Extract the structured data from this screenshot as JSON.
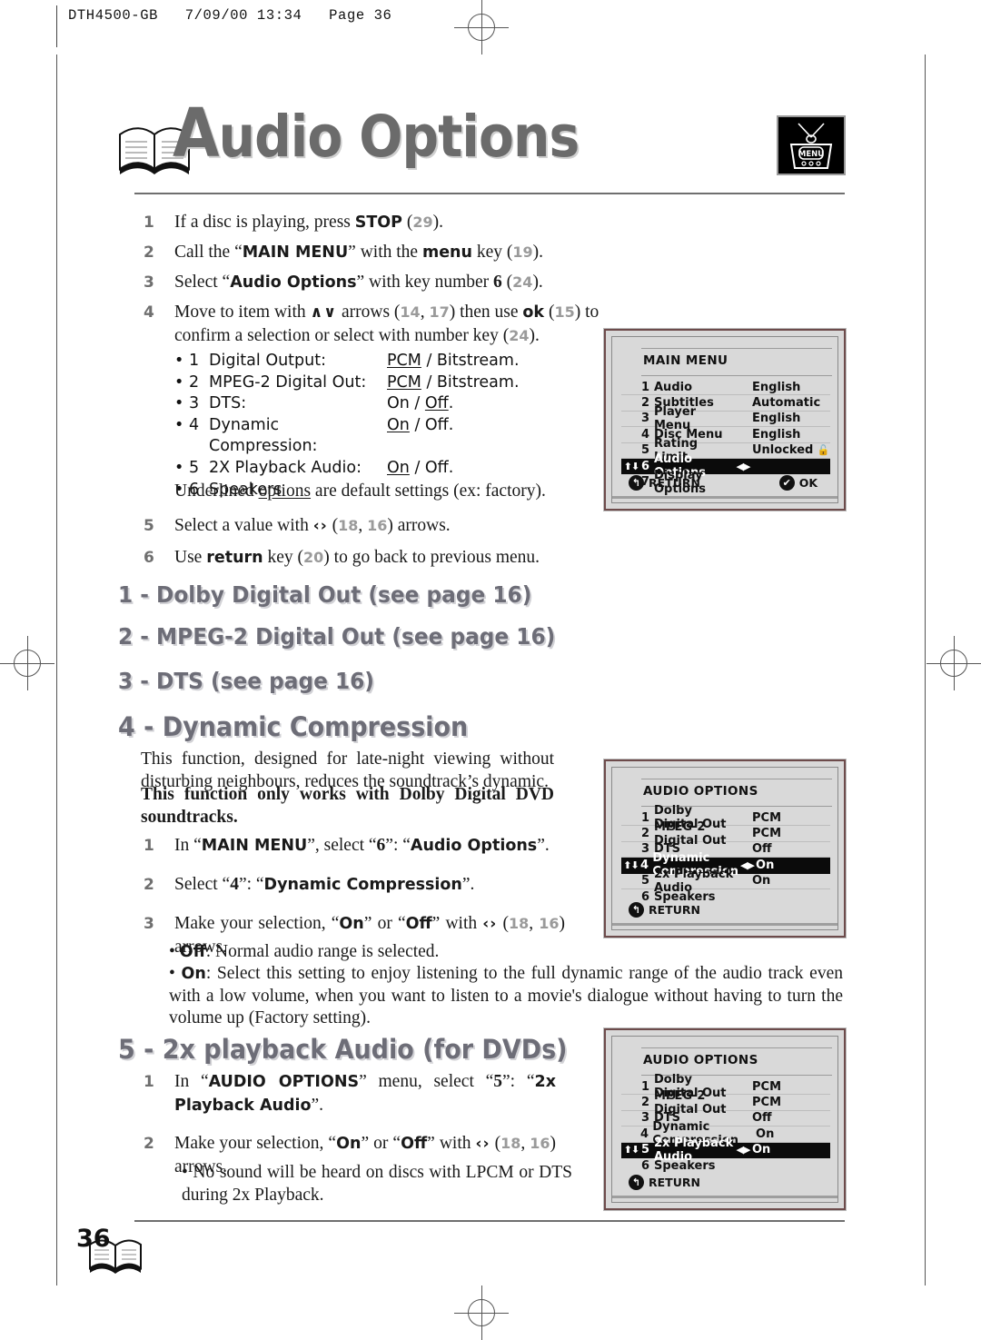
{
  "header": {
    "running_head": "DTH4500-GB   7/09/00 13:34   Page 36"
  },
  "title": {
    "text_cap": "A",
    "text_rest": "udio Options",
    "menu_icon_label": "MENU"
  },
  "intro_steps": [
    {
      "n": "1",
      "html": "If a disc is playing, press <b class=\"sans\">STOP</b> (<span class=\"ref\">29</span>)."
    },
    {
      "n": "2",
      "html": "Call the “<b class=\"sans\">MAIN MENU</b>” with the <b class=\"sans\">menu</b> key (<span class=\"ref\">19</span>)."
    },
    {
      "n": "3",
      "html": "Select “<b class=\"sans\">Audio Options</b>” with key number <b class=\"serif\">6</b> (<span class=\"ref\">24</span>)."
    },
    {
      "n": "4",
      "html": "Move to item with <span class=\"arrglyph\">∧∨</span> arrows (<span class=\"ref\">14</span>, <span class=\"ref\">17</span>) then use <b class=\"sans\">ok</b> (<span class=\"ref\">15</span>) to confirm a selection or select with number key (<span class=\"ref\">24</span>)."
    }
  ],
  "option_list": [
    {
      "index": "1",
      "label": "Digital Output:",
      "value_html": "<u>PCM</u> / Bitstream."
    },
    {
      "index": "2",
      "label": "MPEG-2 Digital Out:",
      "value_html": "<u>PCM</u> / Bitstream."
    },
    {
      "index": "3",
      "label": "DTS:",
      "value_html": "On / <u>Off</u>."
    },
    {
      "index": "4",
      "label": "Dynamic Compression:",
      "value_html": "<u>On</u> / Off."
    },
    {
      "index": "5",
      "label": "2X Playback Audio:",
      "value_html": "<u>On</u> / Off."
    },
    {
      "index": "6",
      "label": "Speakers",
      "value_html": ""
    }
  ],
  "underline_note_html": "Underlined <u>options</u> are default settings (ex: factory).",
  "intro_steps_2": [
    {
      "n": "5",
      "html": "Select a value with <span class=\"arrglyph\">‹›</span> (<span class=\"ref\">18</span>, <span class=\"ref\">16</span>) arrows."
    },
    {
      "n": "6",
      "html": "Use <b class=\"sans\">return</b> key (<span class=\"ref\">20</span>) to go back to previous menu."
    }
  ],
  "headings": {
    "h1": "1 - Dolby Digital Out (see page 16)",
    "h2": "2 - MPEG-2 Digital Out (see page 16)",
    "h3": "3 - DTS (see page 16)",
    "h4": "4 - Dynamic Compression",
    "h5": "5 - 2x playback Audio (for DVDs)"
  },
  "dynamic_compression": {
    "para_normal": "This function, designed for late-night viewing without disturbing neighbours, reduces the soundtrack’s dynamic.",
    "para_bold": "This function only works with Dolby Digital DVD soundtracks.",
    "steps": [
      {
        "n": "1",
        "html": "In “<b class=\"sans\">MAIN MENU</b>”, select “<b class=\"serif\">6</b>”: “<b class=\"sans\">Audio Options</b>”."
      },
      {
        "n": "2",
        "html": "Select “<b class=\"serif\">4</b>”: “<b class=\"sans\">Dynamic Compression</b>”."
      },
      {
        "n": "3",
        "html": "Make your selection, “<b class=\"sans\">On</b>” or “<b class=\"sans\">Off</b>” with <span class=\"arrglyph\">‹›</span> (<span class=\"ref\">18</span>, <span class=\"ref\">16</span>) arrows."
      }
    ],
    "bullet_off": "<b class=\"sans\">Off</b>: Normal audio range is selected.",
    "bullet_on": "<b class=\"sans\">On</b>: Select this setting to enjoy listening to the full  dynamic range of the audio track even with a low volume, when you want to listen to a movie's dialogue without having to turn the volume up (Factory setting)."
  },
  "playback_audio": {
    "steps": [
      {
        "n": "1",
        "html": "In “<b class=\"sans\">AUDIO OPTIONS</b>” menu, select “<b class=\"serif\">5</b>”: “<b class=\"sans\">2x Playback Audio</b>”."
      },
      {
        "n": "2",
        "html": "Make your selection, “<b class=\"sans\">On</b>” or “<b class=\"sans\">Off</b>” with <span class=\"arrglyph\">‹›</span> (<span class=\"ref\">18</span>, <span class=\"ref\">16</span>) arrows."
      }
    ],
    "bullet": "No sound will be heard on discs with LPCM or DTS during 2x Playback."
  },
  "screens": [
    {
      "title": "MAIN MENU",
      "rows": [
        {
          "n": "1",
          "label": "Audio",
          "value": "English",
          "highlight": false,
          "lock": false
        },
        {
          "n": "2",
          "label": "Subtitles",
          "value": "Automatic",
          "highlight": false,
          "lock": false
        },
        {
          "n": "3",
          "label": "Player Menu",
          "value": "English",
          "highlight": false,
          "lock": false
        },
        {
          "n": "4",
          "label": "Disc Menu",
          "value": "English",
          "highlight": false,
          "lock": false
        },
        {
          "n": "5",
          "label": "Rating Limit",
          "value": "Unlocked",
          "highlight": false,
          "lock": true
        },
        {
          "n": "6",
          "label": "Audio Options",
          "value": "",
          "highlight": true,
          "lock": false
        },
        {
          "n": "7",
          "label": "Display Options",
          "value": "",
          "highlight": false,
          "lock": false
        }
      ],
      "footer_left": "RETURN",
      "footer_right": "OK"
    },
    {
      "title": "AUDIO OPTIONS",
      "rows": [
        {
          "n": "1",
          "label": "Dolby Digital Out",
          "value": "PCM",
          "highlight": false,
          "lock": false
        },
        {
          "n": "2",
          "label": "MPEG-2 Digital Out",
          "value": "PCM",
          "highlight": false,
          "lock": false
        },
        {
          "n": "3",
          "label": "DTS",
          "value": "Off",
          "highlight": false,
          "lock": false
        },
        {
          "n": "4",
          "label": "Dynamic Compression",
          "value": "On",
          "highlight": true,
          "lock": false
        },
        {
          "n": "5",
          "label": "2x Playback Audio",
          "value": "On",
          "highlight": false,
          "lock": false
        },
        {
          "n": "6",
          "label": "Speakers",
          "value": "",
          "highlight": false,
          "lock": false
        }
      ],
      "footer_left": "RETURN",
      "footer_right": ""
    },
    {
      "title": "AUDIO OPTIONS",
      "rows": [
        {
          "n": "1",
          "label": "Dolby Digital Out",
          "value": "PCM",
          "highlight": false,
          "lock": false
        },
        {
          "n": "2",
          "label": "MPEG-2 Digital Out",
          "value": "PCM",
          "highlight": false,
          "lock": false
        },
        {
          "n": "3",
          "label": "DTS",
          "value": "Off",
          "highlight": false,
          "lock": false
        },
        {
          "n": "4",
          "label": "Dynamic Compression",
          "value": "On",
          "highlight": false,
          "lock": false
        },
        {
          "n": "5",
          "label": "2x Playback Audio",
          "value": "On",
          "highlight": true,
          "lock": false
        },
        {
          "n": "6",
          "label": "Speakers",
          "value": "",
          "highlight": false,
          "lock": false
        }
      ],
      "footer_left": "RETURN",
      "footer_right": ""
    }
  ],
  "footer": {
    "page_number": "36"
  },
  "glyphs": {
    "updown": "⬆⬇",
    "leftright": "◀▶",
    "return_badge": "↰",
    "ok_badge": "✔"
  },
  "colors": {
    "heading_gray": "#6d6d77",
    "title_gray": "#6b6b6b",
    "ref_gray": "#9a9a9a",
    "screen_bg": "#d9d9d9",
    "screen_border": "#6d4b4b",
    "highlight_bg": "#0b0b0b"
  }
}
